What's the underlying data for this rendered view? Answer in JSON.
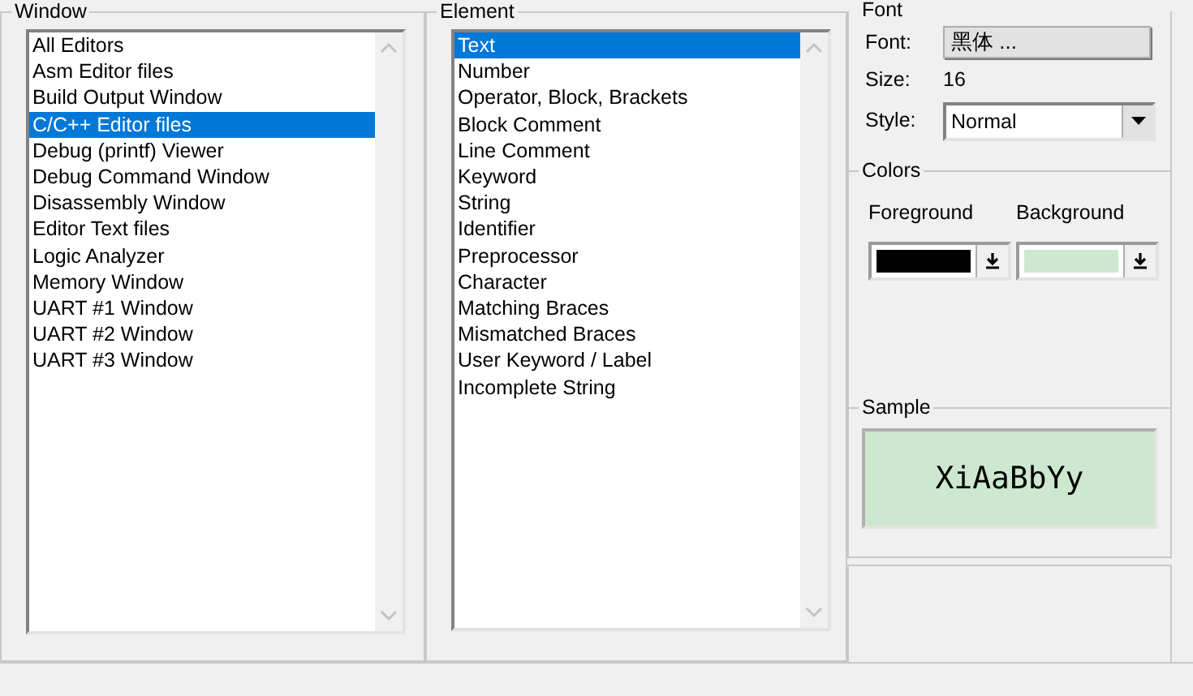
{
  "window_group": {
    "title": "Window",
    "items": [
      {
        "label": "All Editors",
        "selected": false
      },
      {
        "label": "Asm Editor files",
        "selected": false
      },
      {
        "label": "Build Output Window",
        "selected": false
      },
      {
        "label": "C/C++ Editor files",
        "selected": true
      },
      {
        "label": "Debug (printf) Viewer",
        "selected": false
      },
      {
        "label": "Debug Command Window",
        "selected": false
      },
      {
        "label": "Disassembly Window",
        "selected": false
      },
      {
        "label": "Editor Text files",
        "selected": false
      },
      {
        "label": "Logic Analyzer",
        "selected": false
      },
      {
        "label": "Memory Window",
        "selected": false
      },
      {
        "label": "UART #1 Window",
        "selected": false
      },
      {
        "label": "UART #2 Window",
        "selected": false
      },
      {
        "label": "UART #3 Window",
        "selected": false
      }
    ]
  },
  "element_group": {
    "title": "Element",
    "items": [
      {
        "label": "Text",
        "selected": true
      },
      {
        "label": "Number",
        "selected": false
      },
      {
        "label": "Operator, Block, Brackets",
        "selected": false
      },
      {
        "label": "Block Comment",
        "selected": false
      },
      {
        "label": "Line Comment",
        "selected": false
      },
      {
        "label": "Keyword",
        "selected": false
      },
      {
        "label": "String",
        "selected": false
      },
      {
        "label": "Identifier",
        "selected": false
      },
      {
        "label": "Preprocessor",
        "selected": false
      },
      {
        "label": "Character",
        "selected": false
      },
      {
        "label": "Matching Braces",
        "selected": false
      },
      {
        "label": "Mismatched Braces",
        "selected": false
      },
      {
        "label": "User Keyword / Label",
        "selected": false
      },
      {
        "label": "Incomplete String",
        "selected": false
      }
    ]
  },
  "font_group": {
    "title": "Font",
    "font_label": "Font:",
    "font_button": "黑体 ...",
    "size_label": "Size:",
    "size_value": "16",
    "style_label": "Style:",
    "style_value": "Normal"
  },
  "colors_group": {
    "title": "Colors",
    "foreground": {
      "label": "Foreground",
      "color": "#000000"
    },
    "background": {
      "label": "Background",
      "color": "#cde8cf"
    }
  },
  "sample_group": {
    "title": "Sample",
    "text": "XiAaBbYy"
  }
}
